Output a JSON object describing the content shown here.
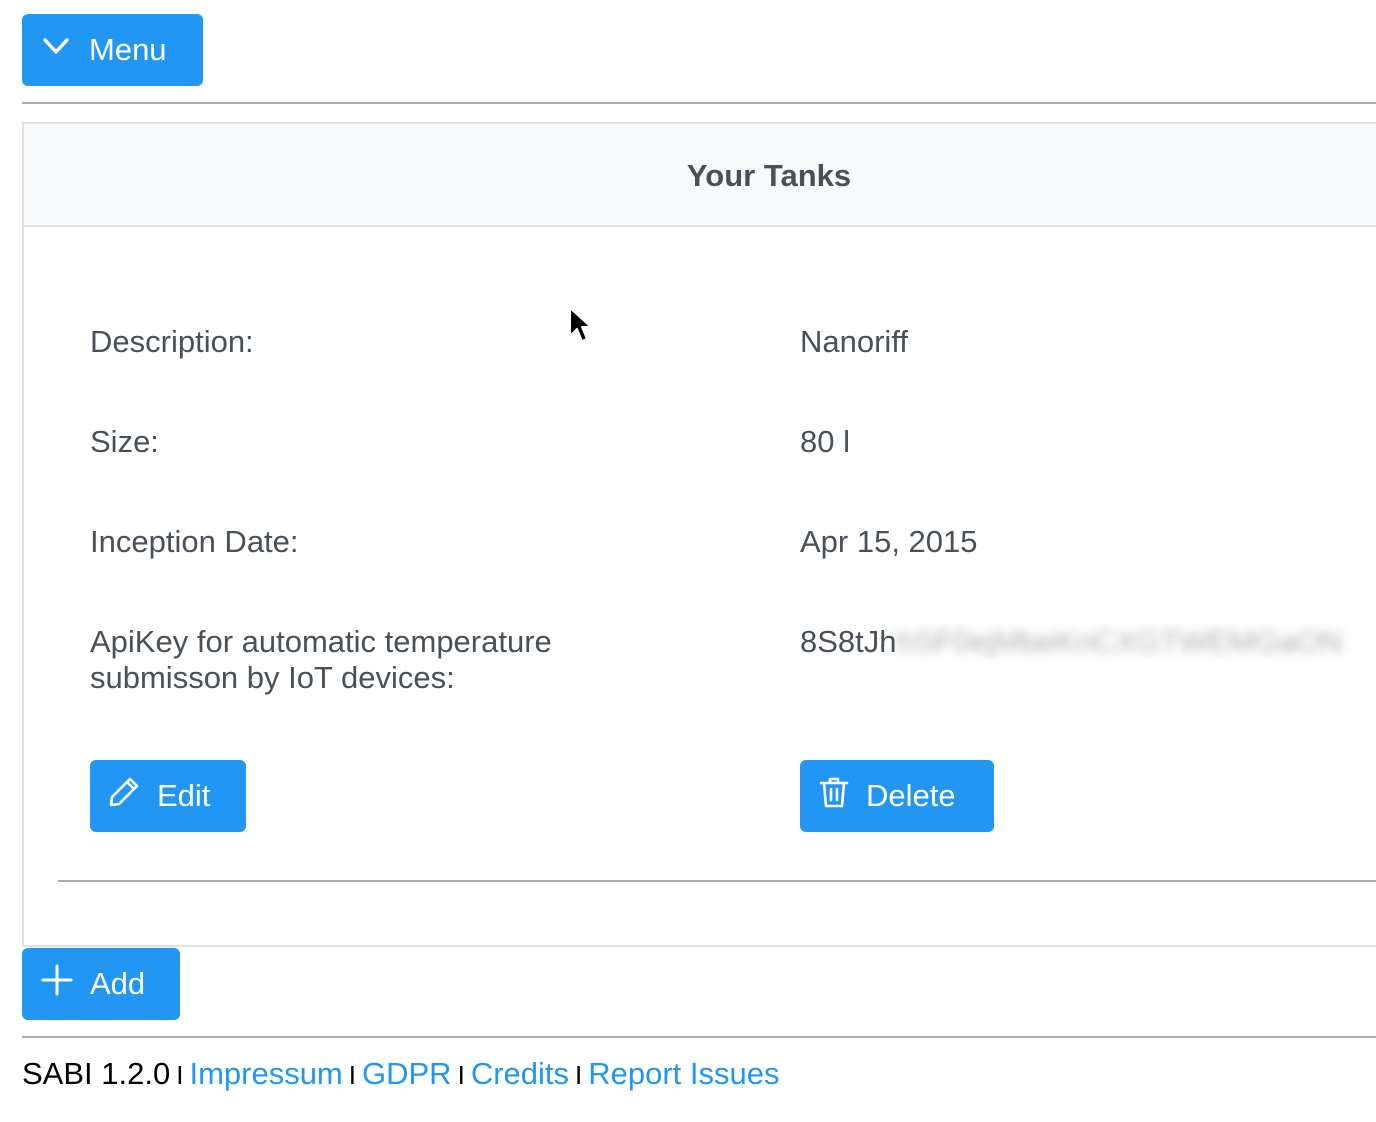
{
  "colors": {
    "accent": "#2196F3",
    "text": "#495057",
    "header_bg": "#f8f9fa"
  },
  "header": {
    "menu_label": "Menu",
    "menu_icon": "chevron-down-icon"
  },
  "tanks": {
    "title": "Your Tanks",
    "fields": [
      {
        "label": "Description:",
        "value": "Nanoriff"
      },
      {
        "label": "Size:",
        "value": "80 l"
      },
      {
        "label": "Inception Date:",
        "value": "Apr 15, 2015"
      },
      {
        "label_line1": "ApiKey for automatic temperature",
        "label_line2": "submisson by IoT devices:",
        "value_visible": "8S8tJh",
        "value_blurred": "hSF0ejMbeKnCXGTWEMGaON"
      }
    ],
    "edit_label": "Edit",
    "delete_label": "Delete"
  },
  "add_label": "Add",
  "footer": {
    "version": "SABI 1.2.0",
    "separator": "I",
    "links": [
      "Impressum",
      "GDPR",
      "Credits",
      "Report Issues"
    ]
  }
}
